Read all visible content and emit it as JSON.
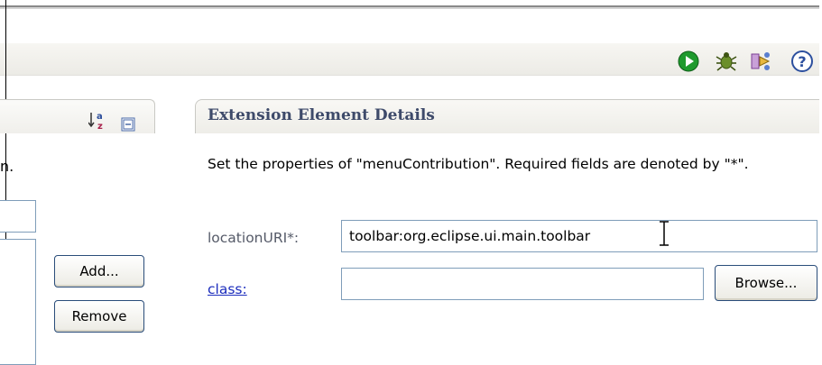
{
  "toolbar": {
    "icons": [
      "run-icon",
      "debug-icon",
      "profile-icon",
      "help-icon"
    ],
    "help_glyph": "?"
  },
  "left_pane": {
    "note_fragment": "n.",
    "filter_value": "",
    "add_label": "Add...",
    "remove_label": "Remove",
    "icons": [
      "sort-alpha-icon",
      "collapse-all-icon"
    ]
  },
  "details": {
    "title": "Extension Element Details",
    "description": "Set the properties of \"menuContribution\". Required fields are denoted by \"*\".",
    "location_label": "locationURI*:",
    "location_value": "toolbar:org.eclipse.ui.main.toolbar",
    "class_label": "class:",
    "class_value": "",
    "browse_label": "Browse..."
  },
  "colors": {
    "title": "#3e4a6a",
    "link": "#1c2dbd",
    "field_border": "#7f9db9",
    "button_border": "#2a4d7a",
    "run_green": "#1f9a2e"
  }
}
